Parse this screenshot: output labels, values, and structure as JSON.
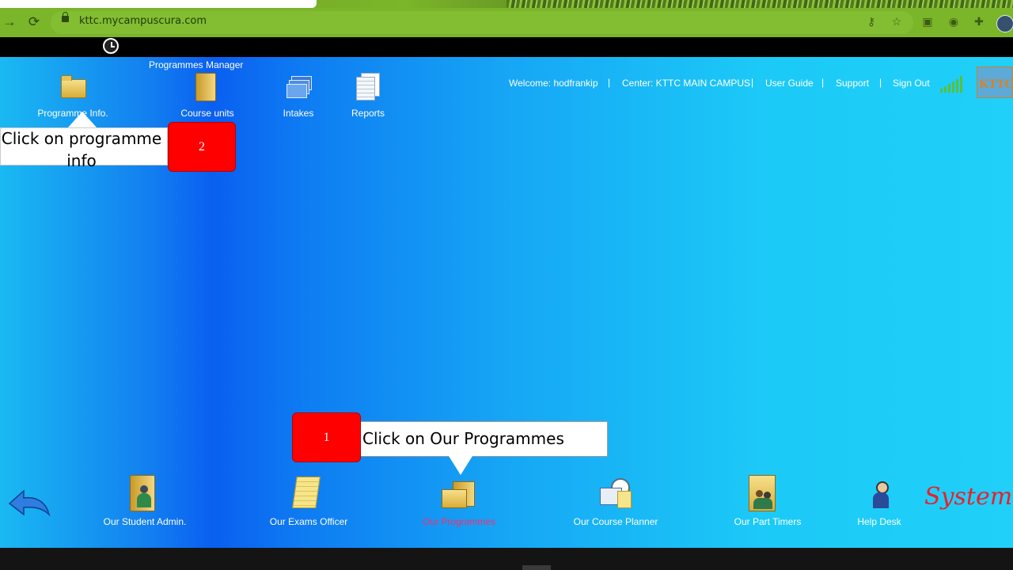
{
  "browser": {
    "url": "kttc.mycampuscura.com"
  },
  "header": {
    "manager_title": "Programmes Manager",
    "top_items": [
      {
        "label": "Programme Info.",
        "icon": "folder-icon"
      },
      {
        "label": "Course units",
        "icon": "folder-open-icon"
      },
      {
        "label": "Intakes",
        "icon": "stack-icon"
      },
      {
        "label": "Reports",
        "icon": "reports-icon"
      }
    ],
    "welcome": "Welcome: hodfrankip",
    "center": "Center: KTTC MAIN CAMPUS",
    "user_guide": "User Guide",
    "support": "Support",
    "sign_out": "Sign Out",
    "separator": "|",
    "logo_text": "KTTC"
  },
  "callouts": {
    "step2": {
      "number": "2",
      "text": "Click on programme info"
    },
    "step1": {
      "number": "1",
      "text": "Click on Our Programmes"
    }
  },
  "bottom_nav": [
    {
      "label": "Our Student Admin.",
      "icon": "student-admin-icon"
    },
    {
      "label": "Our Exams Officer",
      "icon": "notepad-icon"
    },
    {
      "label": "Our Programmes",
      "icon": "folders-icon",
      "active": true
    },
    {
      "label": "Our Course Planner",
      "icon": "planner-icon"
    },
    {
      "label": "Our Part Timers",
      "icon": "part-timers-icon"
    },
    {
      "label": "Help Desk",
      "icon": "help-desk-icon"
    }
  ],
  "brand": {
    "text": "System"
  },
  "colors": {
    "active_label": "#ff2a6d",
    "badge": "#ff0000",
    "app_bg": "#127ef0"
  }
}
